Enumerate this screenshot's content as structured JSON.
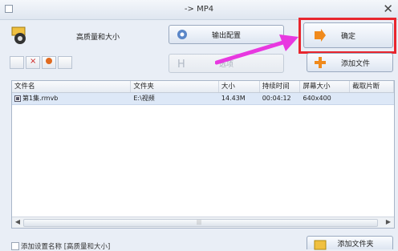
{
  "window": {
    "title": "-> MP4"
  },
  "profile": {
    "label": "高质量和大小"
  },
  "buttons": {
    "output_config": "输出配置",
    "ok": "确定",
    "options": "选项",
    "add_file": "添加文件",
    "add_folder": "添加文件夹"
  },
  "table": {
    "headers": [
      "文件名",
      "文件夹",
      "大小",
      "持续时间",
      "屏幕大小",
      "截取片断"
    ],
    "rows": [
      {
        "name": "第1集.rmvb",
        "folder": "E:\\视频",
        "size": "14.43M",
        "duration": "00:04:12",
        "screen": "640x400",
        "clip": ""
      }
    ]
  },
  "bottom": {
    "checkbox_label": "添加设置名称 [高质量和大小]"
  },
  "colors": {
    "highlight": "#e8262e",
    "arrow": "#e838e0"
  }
}
